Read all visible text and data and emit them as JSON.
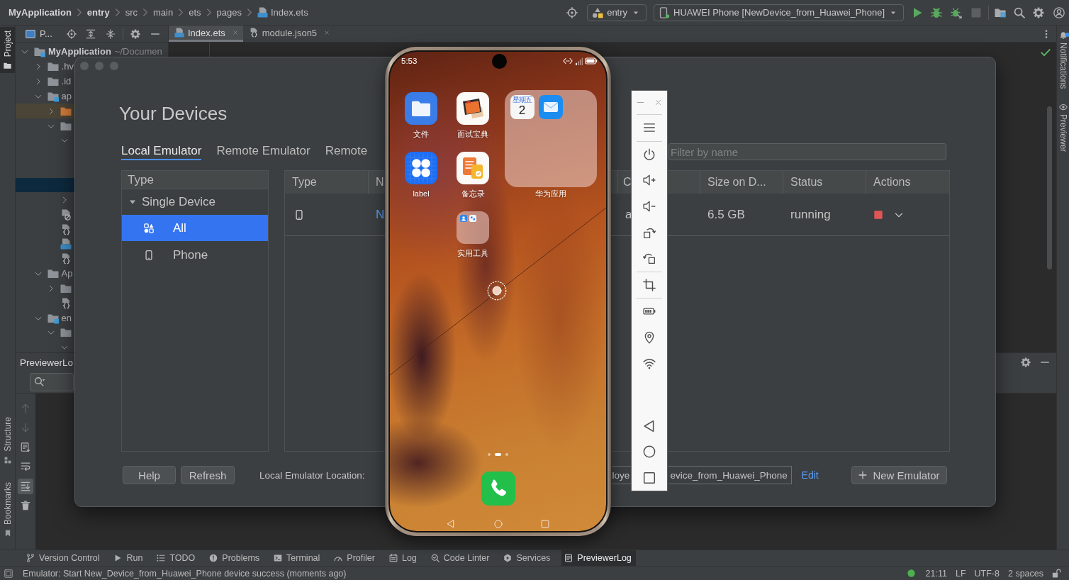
{
  "top_bar": {
    "breadcrumbs": [
      {
        "label": "MyApplication",
        "kind": "project"
      },
      {
        "label": "entry",
        "kind": "module"
      },
      {
        "label": "src",
        "kind": "folder"
      },
      {
        "label": "main",
        "kind": "folder"
      },
      {
        "label": "ets",
        "kind": "folder"
      },
      {
        "label": "pages",
        "kind": "folder"
      },
      {
        "label": "Index.ets",
        "kind": "ets-file"
      }
    ],
    "module_selector": {
      "label": "entry"
    },
    "device_selector": {
      "label": "HUAWEI Phone [NewDevice_from_Huawei_Phone]"
    },
    "stop_button": {
      "disabled": true
    }
  },
  "left_stripe": {
    "top": [
      {
        "label": "Project",
        "kind": "project",
        "selected": true
      }
    ],
    "bottom": [
      {
        "label": "Structure",
        "kind": "structure",
        "selected": false
      },
      {
        "label": "Bookmarks",
        "kind": "bookmarks",
        "selected": false
      }
    ]
  },
  "right_stripe": [
    {
      "label": "Notifications",
      "kind": "notifications",
      "unread": true
    },
    {
      "label": "Previewer",
      "kind": "previewer",
      "unread": false
    }
  ],
  "project_panel": {
    "title": "P...",
    "tree": [
      {
        "label": "MyApplication",
        "detail": "~/Documen",
        "kind": "module",
        "expanded": true,
        "selected": false,
        "children": [
          {
            "label": ".hv",
            "kind": "folder",
            "expanded": false,
            "selected": false
          },
          {
            "label": ".id",
            "kind": "folder",
            "expanded": false,
            "selected": false
          },
          {
            "label": "ap",
            "kind": "module",
            "expanded": true,
            "selected": false,
            "children": [
              {
                "kind": "excluded-folder",
                "expanded": false,
                "selected": false
              },
              {
                "kind": "folder",
                "expanded": true,
                "selected": false,
                "children": [
                  {
                    "expanded": true,
                    "selected": false,
                    "children": [
                      {
                        "selected": false
                      },
                      {
                        "selected": false
                      },
                      {
                        "selected": true
                      }
                    ]
                  },
                  {
                    "expanded": false,
                    "selected": false
                  }
                ]
              },
              {
                "kind": "ignore-file",
                "selected": false
              },
              {
                "kind": "json-file",
                "selected": false
              },
              {
                "kind": "ts-file",
                "selected": false
              },
              {
                "kind": "json-file",
                "selected": false
              }
            ]
          },
          {
            "label": "Ap",
            "kind": "folder",
            "expanded": true,
            "selected": false,
            "children": [
              {
                "kind": "folder",
                "expanded": false,
                "selected": false
              },
              {
                "kind": "json-file",
                "selected": false
              }
            ]
          },
          {
            "label": "en",
            "kind": "module",
            "expanded": true,
            "selected": false,
            "children": [
              {
                "kind": "folder",
                "expanded": true,
                "selected": false,
                "children": [
                  {
                    "expanded": true,
                    "selected": false
                  }
                ]
              }
            ]
          }
        ]
      }
    ]
  },
  "editor": {
    "tabs": [
      {
        "label": "Index.ets",
        "kind": "ets-file",
        "selected": true
      },
      {
        "label": "module.json5",
        "kind": "json-file",
        "selected": false
      }
    ]
  },
  "log_panel": {
    "title": "PreviewerLo",
    "tools": [
      {
        "kind": "up",
        "disabled": true,
        "selected": false
      },
      {
        "kind": "down",
        "disabled": true,
        "selected": false
      },
      {
        "kind": "document",
        "disabled": false,
        "selected": false
      },
      {
        "kind": "soft-wrap",
        "disabled": false,
        "selected": false
      },
      {
        "kind": "scroll-to-end",
        "disabled": false,
        "selected": true
      },
      {
        "kind": "clear",
        "disabled": false,
        "selected": false
      }
    ]
  },
  "tool_windows": [
    {
      "label": "Version Control",
      "kind": "vcs",
      "selected": false
    },
    {
      "label": "Run",
      "kind": "run",
      "selected": false
    },
    {
      "label": "TODO",
      "kind": "todo",
      "selected": false
    },
    {
      "label": "Problems",
      "kind": "problems",
      "selected": false
    },
    {
      "label": "Terminal",
      "kind": "terminal",
      "selected": false
    },
    {
      "label": "Profiler",
      "kind": "profiler",
      "selected": false
    },
    {
      "label": "Log",
      "kind": "log",
      "selected": false
    },
    {
      "label": "Code Linter",
      "kind": "linter",
      "selected": false
    },
    {
      "label": "Services",
      "kind": "services",
      "selected": false
    },
    {
      "label": "PreviewerLog",
      "kind": "previewer-log",
      "selected": true
    }
  ],
  "status_bar": {
    "message": "Emulator: Start New_Device_from_Huawei_Phone device success (moments ago)",
    "caret_position": "21:11",
    "line_separator": "LF",
    "encoding": "UTF-8",
    "indent": "2 spaces"
  },
  "devices_dialog": {
    "title": "Your Devices",
    "tabs": [
      {
        "label": "Local Emulator",
        "selected": true
      },
      {
        "label": "Remote Emulator",
        "selected": false
      },
      {
        "label": "Remote",
        "selected": false
      }
    ],
    "filter": {
      "placeholder": "Filter by name"
    },
    "type_panel": {
      "header": "Type",
      "groups": [
        {
          "label": "Single Device",
          "expanded": true,
          "children": [
            {
              "label": "All",
              "kind": "all",
              "selected": true
            },
            {
              "label": "Phone",
              "kind": "phone",
              "selected": false
            }
          ]
        }
      ]
    },
    "table": {
      "columns": [
        "Type",
        "N",
        "C",
        "Size on D...",
        "Status",
        "Actions"
      ],
      "rows": [
        {
          "kind": "phone",
          "name": "N",
          "column_3": "a",
          "size": "6.5 GB",
          "status": "running",
          "running": true
        }
      ]
    },
    "buttons": [
      {
        "label": "Help"
      },
      {
        "label": "Refresh"
      }
    ],
    "location": {
      "label": "Local Emulator Location:",
      "value_parts": [
        "loye",
        "evice_from_Huawei_Phone"
      ]
    },
    "edit_link": "Edit",
    "new_button": "New Emulator"
  },
  "emulator": {
    "status_time": "5:53",
    "apps": [
      {
        "label": "文件",
        "kind": "files"
      },
      {
        "label": "面试宝典",
        "kind": "book"
      },
      {
        "label": "label",
        "kind": "clover"
      },
      {
        "label": "备忘录",
        "kind": "notes"
      },
      {
        "label": "华为应用",
        "kind": "large-folder",
        "apps": [
          {
            "kind": "calendar",
            "weekday": "星期五",
            "day": "2"
          },
          {
            "kind": "mail"
          }
        ]
      },
      {
        "label": "实用工具",
        "kind": "folder",
        "apps": [
          {
            "kind": "contacts"
          },
          {
            "kind": "tools"
          }
        ]
      }
    ],
    "page_dots": [
      {
        "selected": false
      },
      {
        "selected": true
      },
      {
        "selected": false
      }
    ]
  }
}
